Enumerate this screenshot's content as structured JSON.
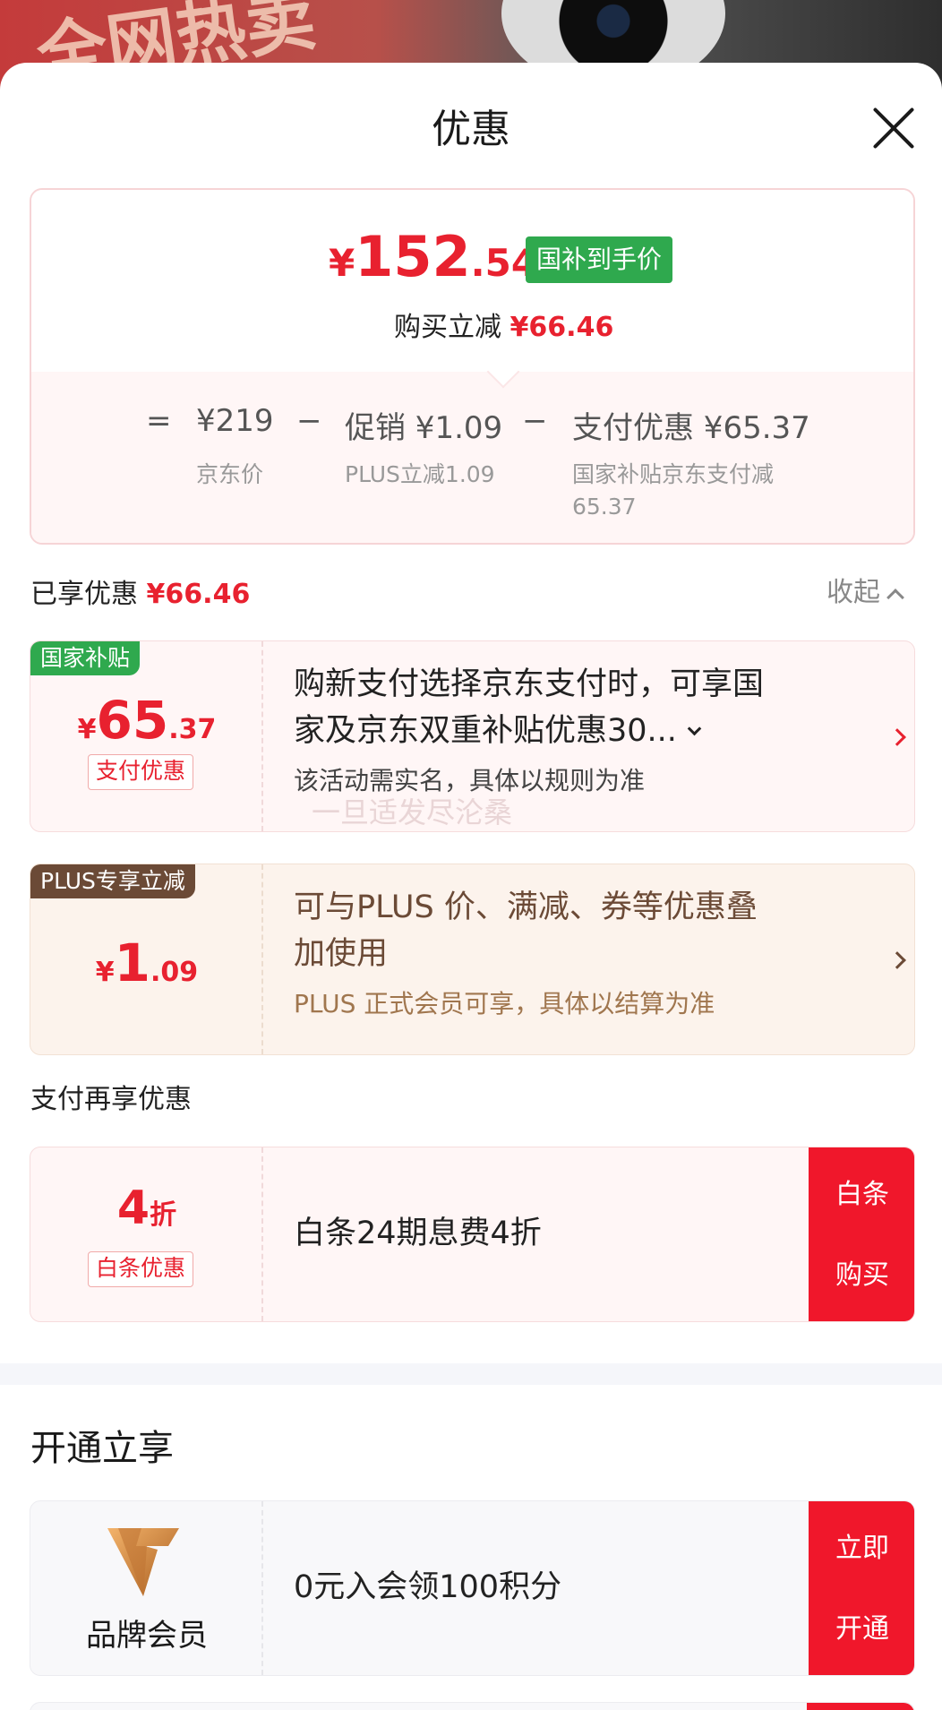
{
  "background": {
    "banner_text": "全网热卖"
  },
  "sheet": {
    "title": "优惠"
  },
  "summary": {
    "price_currency": "¥",
    "price_int": "152",
    "price_dec": ".54",
    "badge": "国补到手价",
    "reduce_label": "购买立减",
    "reduce_value": "¥66.46",
    "equals": "=",
    "minus": "−",
    "base_value": "¥219",
    "base_label": "京东价",
    "promo_value": "促销 ¥1.09",
    "promo_label": "PLUS立减1.09",
    "pay_value": "支付优惠 ¥65.37",
    "pay_label_1": "国家补贴京东支付减",
    "pay_label_2": "65.37"
  },
  "enjoyed": {
    "label": "已享优惠",
    "value": "¥66.46",
    "collapse": "收起"
  },
  "coupon_subsidy": {
    "tag": "国家补贴",
    "currency": "¥",
    "int": "65",
    "dec": ".37",
    "chip": "支付优惠",
    "line1": "购新支付选择京东支付时，可享国",
    "line2": "家及京东双重补贴优惠30...",
    "sub": "该活动需实名，具体以规则为准",
    "watermark": "一旦适发尽沦桑"
  },
  "coupon_plus": {
    "tag": "PLUS专享立减",
    "currency": "¥",
    "int": "1",
    "dec": ".09",
    "line1": "可与PLUS 价、满减、券等优惠叠",
    "line2": "加使用",
    "sub": "PLUS 正式会员可享，具体以结算为准"
  },
  "pay_more": {
    "title": "支付再享优惠"
  },
  "coupon_baitiao": {
    "int": "4",
    "unit": "折",
    "chip": "白条优惠",
    "text": "白条24期息费4折",
    "btn_line1": "白条",
    "btn_line2": "购买"
  },
  "open_section": {
    "title": "开通立享"
  },
  "coupon_member": {
    "label": "品牌会员",
    "text": "0元入会领100积分",
    "btn_line1": "立即",
    "btn_line2": "开通"
  },
  "colors": {
    "accent": "#e8212f",
    "green": "#2fa94e",
    "plus_brown": "#6b4a36",
    "button_red": "#f0172b"
  }
}
